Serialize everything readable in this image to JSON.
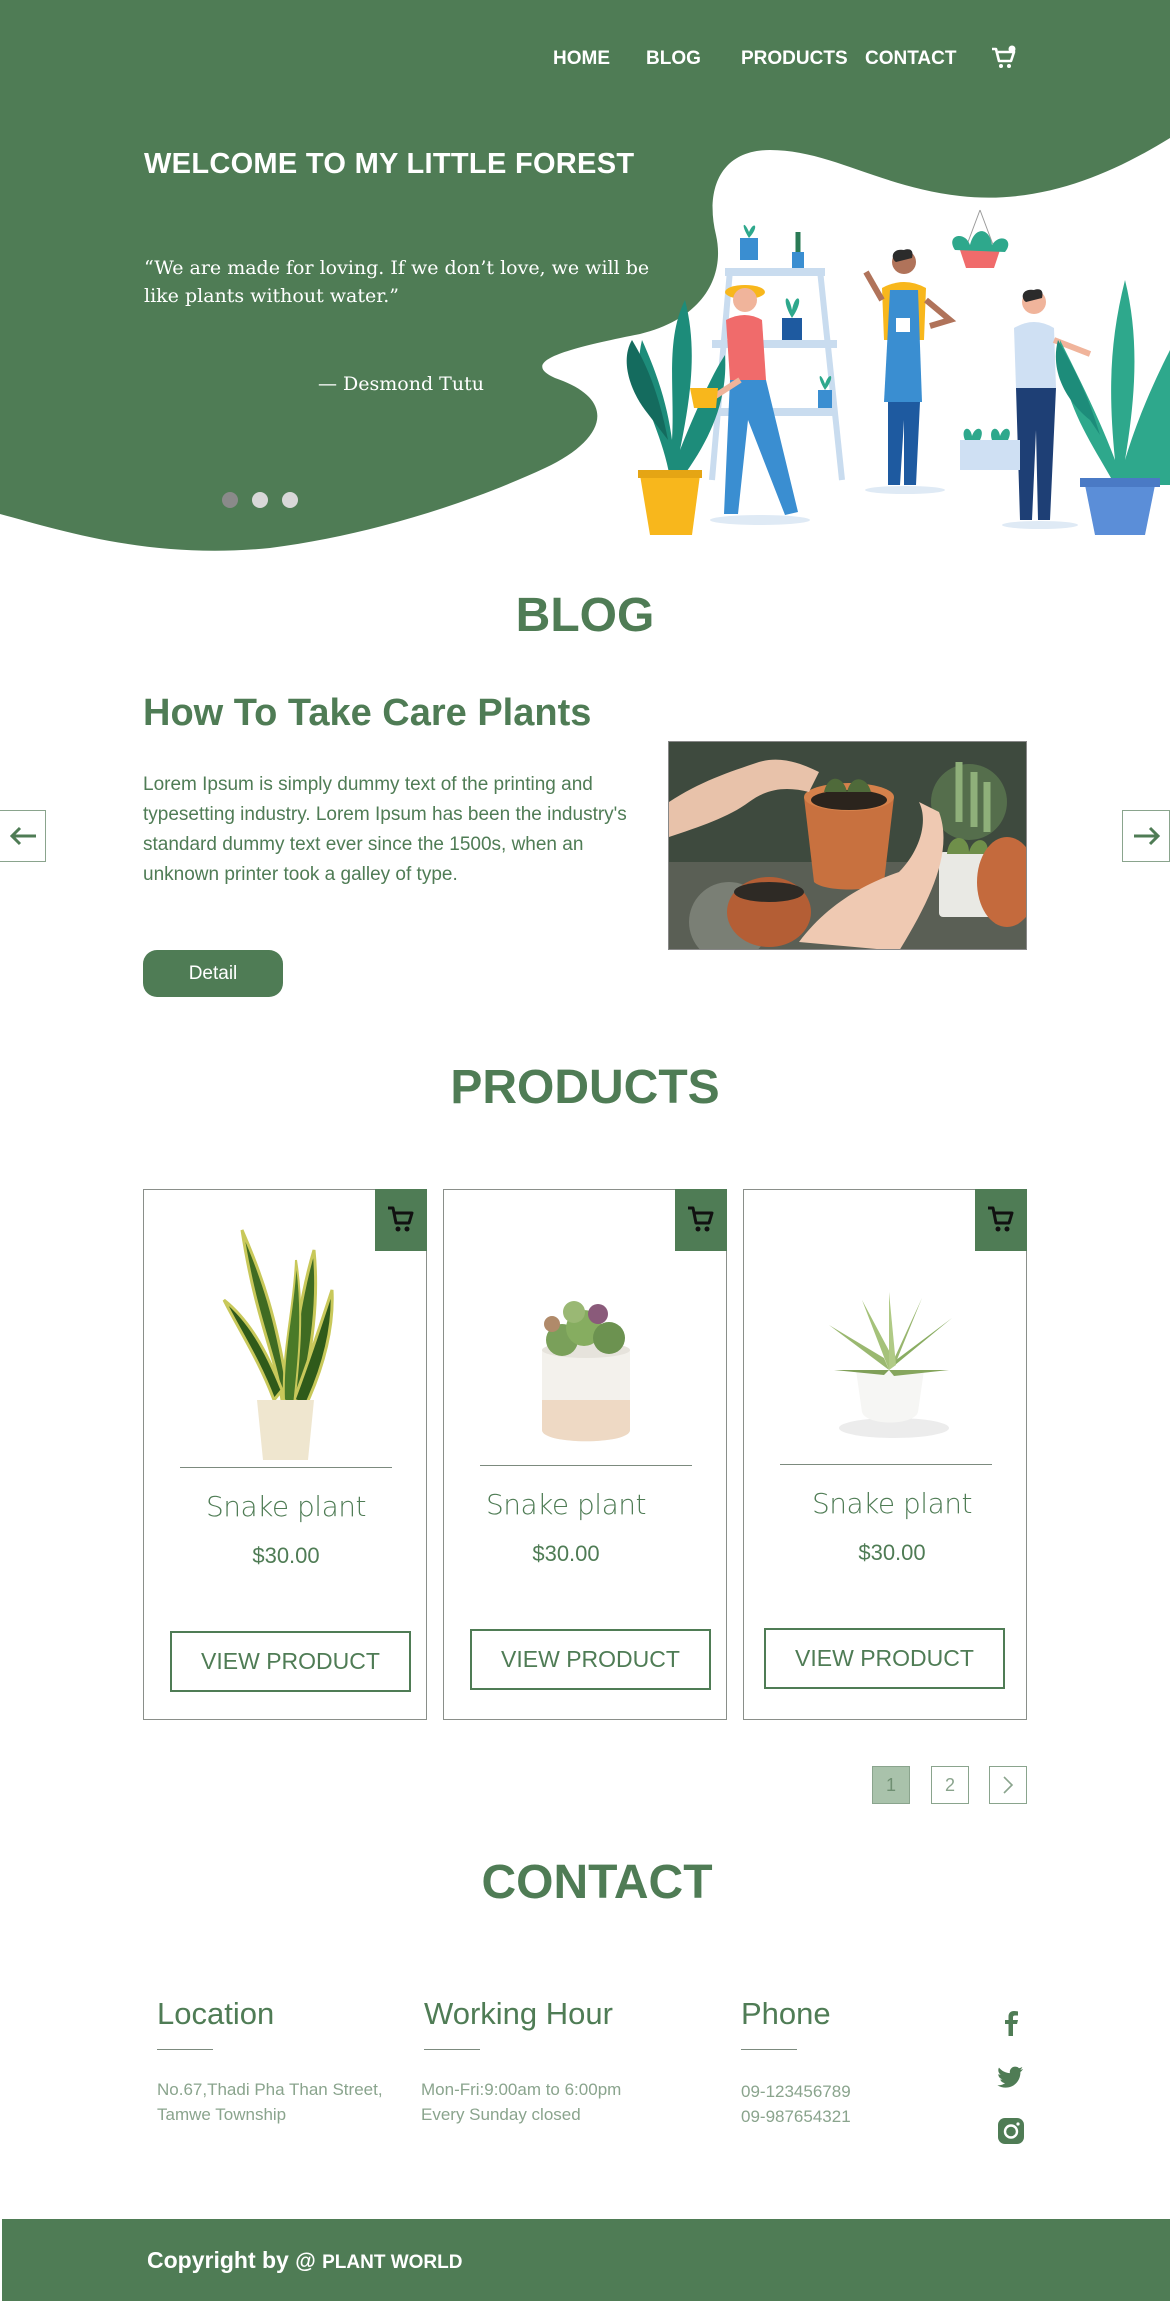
{
  "nav": {
    "items": [
      "HOME",
      "BLOG",
      "PRODUCTS",
      "CONTACT"
    ]
  },
  "icons": {
    "cart": "cart-icon",
    "arrow_left": "arrow-left-icon",
    "arrow_right": "arrow-right-icon",
    "facebook": "facebook-icon",
    "twitter": "twitter-icon",
    "instagram": "instagram-icon",
    "chevron_right": "chevron-right-icon"
  },
  "colors": {
    "brand_green": "#4f7c55",
    "light_green": "#8aa48d",
    "pager_active": "#a9c2ab"
  },
  "hero": {
    "title": "WELCOME TO MY LITTLE  FOREST",
    "quote": "“We are made for loving. If we don’t love, we will be like plants without water.”",
    "author": "— Desmond Tutu",
    "slides": 3,
    "active_slide": 1
  },
  "blog": {
    "section_title": "BLOG",
    "heading": "How To Take Care Plants",
    "body": "Lorem Ipsum is simply dummy text of the printing and typesetting industry. Lorem Ipsum has been the industry's standard dummy text ever since the 1500s, when an unknown printer took a galley of type.",
    "button": "Detail"
  },
  "products": {
    "section_title": "PRODUCTS",
    "items": [
      {
        "name": "Snake plant",
        "price": "$30.00",
        "button": "VIEW PRODUCT"
      },
      {
        "name": "Snake plant",
        "price": "$30.00",
        "button": "VIEW PRODUCT"
      },
      {
        "name": "Snake plant",
        "price": "$30.00",
        "button": "VIEW PRODUCT"
      }
    ],
    "pagination": {
      "pages": [
        "1",
        "2"
      ],
      "active": "1"
    }
  },
  "contact": {
    "section_title": "CONTACT",
    "location": {
      "title": "Location",
      "lines": [
        "No.67,Thadi Pha Than Street,",
        "Tamwe Township"
      ]
    },
    "hours": {
      "title": "Working Hour",
      "lines": [
        "Mon-Fri:9:00am to 6:00pm",
        "Every Sunday closed"
      ]
    },
    "phone": {
      "title": "Phone",
      "lines": [
        "09-123456789",
        "09-987654321"
      ]
    }
  },
  "footer": {
    "prefix": "Copyright by",
    "at": "@",
    "brand": "PLANT WORLD"
  }
}
